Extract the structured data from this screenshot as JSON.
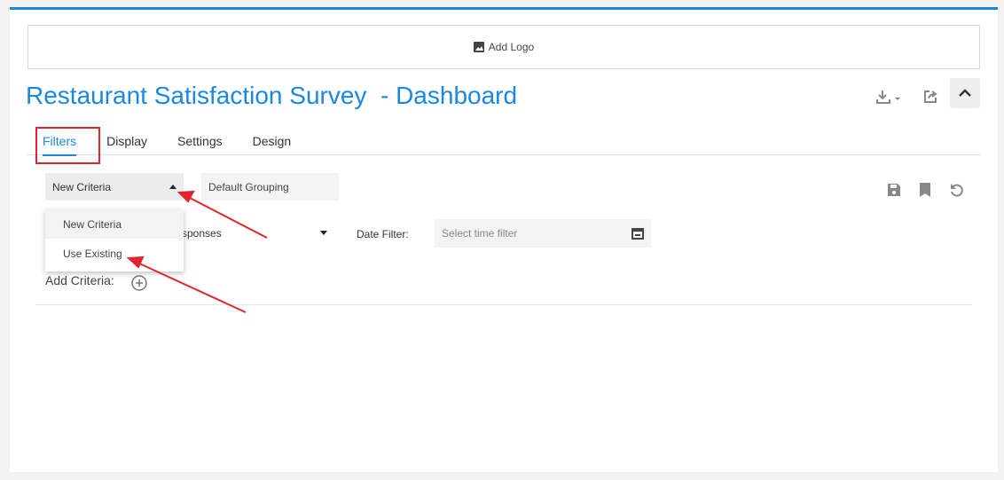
{
  "logo": {
    "label": "Add Logo"
  },
  "title": "Restaurant Satisfaction Survey  - Dashboard",
  "tabs": [
    "Filters",
    "Display",
    "Settings",
    "Design"
  ],
  "criteria_select": {
    "value": "New Criteria",
    "options": [
      "New Criteria",
      "Use Existing"
    ]
  },
  "grouping": {
    "value": "Default Grouping"
  },
  "responses_select": {
    "value": "sponses"
  },
  "date_filter": {
    "label": "Date Filter:",
    "placeholder": "Select time filter"
  },
  "add_criteria": {
    "label": "Add Criteria:"
  },
  "colors": {
    "accent": "#1a88e3",
    "annotation": "#e0262c"
  }
}
